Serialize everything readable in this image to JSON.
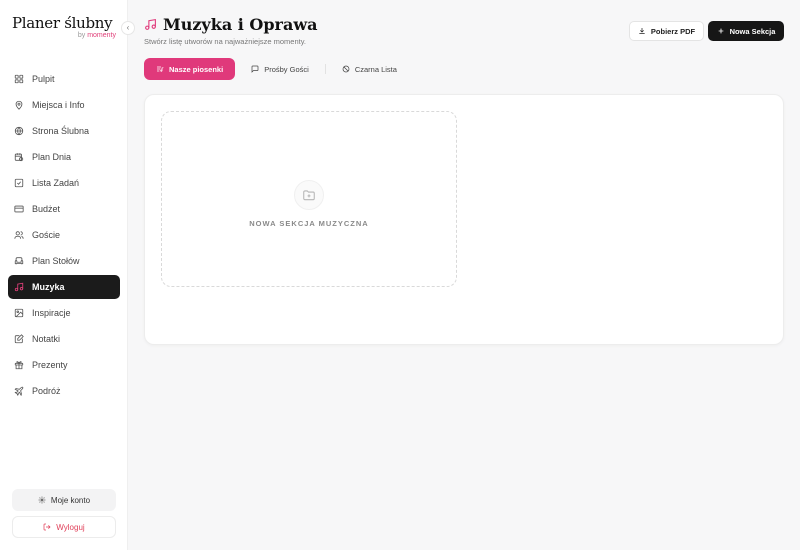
{
  "brand": {
    "title": "Planer ślubny",
    "by": "by",
    "company": "momenty"
  },
  "sidebar": {
    "collapse_glyph": "‹",
    "items": [
      {
        "label": "Pulpit",
        "icon": "dashboard-icon"
      },
      {
        "label": "Miejsca i Info",
        "icon": "map-pin-icon"
      },
      {
        "label": "Strona Ślubna",
        "icon": "globe-icon"
      },
      {
        "label": "Plan Dnia",
        "icon": "calendar-clock-icon"
      },
      {
        "label": "Lista Zadań",
        "icon": "checkbox-icon"
      },
      {
        "label": "Budżet",
        "icon": "credit-card-icon"
      },
      {
        "label": "Goście",
        "icon": "users-icon"
      },
      {
        "label": "Plan Stołów",
        "icon": "armchair-icon"
      },
      {
        "label": "Muzyka",
        "icon": "music-note-icon",
        "active": true
      },
      {
        "label": "Inspiracje",
        "icon": "image-icon"
      },
      {
        "label": "Notatki",
        "icon": "note-edit-icon"
      },
      {
        "label": "Prezenty",
        "icon": "gift-icon"
      },
      {
        "label": "Podróż",
        "icon": "plane-icon"
      }
    ],
    "account_label": "Moje konto",
    "logout_label": "Wyloguj"
  },
  "header": {
    "title": "Muzyka i Oprawa",
    "subtitle": "Stwórz listę utworów na najważniejsze momenty.",
    "pdf_button": "Pobierz PDF",
    "new_section_button": "Nowa Sekcja"
  },
  "tabs": [
    {
      "label": "Nasze piosenki",
      "icon": "list-music-icon",
      "active": true
    },
    {
      "label": "Prośby Gości",
      "icon": "message-icon"
    },
    {
      "label": "Czarna Lista",
      "icon": "ban-icon"
    }
  ],
  "main": {
    "new_section_card_label": "NOWA SEKCJA MUZYCZNA"
  },
  "colors": {
    "accent": "#e0397b",
    "dark": "#161616",
    "background": "#f7f7f8"
  }
}
